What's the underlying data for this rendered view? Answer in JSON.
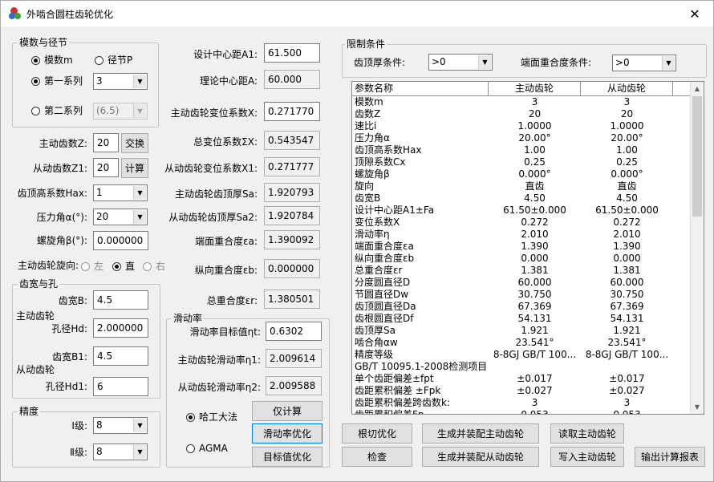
{
  "window": {
    "title": "外啮合圆柱齿轮优化",
    "close_glyph": "✕"
  },
  "module_group": {
    "title": "模数与径节",
    "radio_module": "模数m",
    "radio_pitch": "径节P",
    "radio_series1": "第一系列",
    "series1_value": "3",
    "radio_series2": "第二系列",
    "series2_value": "(6.5)"
  },
  "left_fields": {
    "z1_label": "主动齿数Z:",
    "z1_value": "20",
    "swap_button": "交换",
    "z2_label": "从动齿数Z1:",
    "z2_value": "20",
    "calc_button": "计算",
    "hax_label": "齿顶高系数Hax:",
    "hax_value": "1",
    "alpha_label": "压力角α(°):",
    "alpha_value": "20",
    "beta_label": "螺旋角β(°):",
    "beta_value": "0.000000",
    "direction_label": "主动齿轮旋向:",
    "dir_left": "左",
    "dir_straight": "直",
    "dir_right": "右"
  },
  "width_group": {
    "title": "齿宽与孔",
    "driving_label": "主动齿轮",
    "driven_label": "从动齿轮",
    "b_label": "齿宽B:",
    "b_value": "4.5",
    "hd_label": "孔径Hd:",
    "hd_value": "2.000000",
    "b1_label": "齿宽B1:",
    "b1_value": "4.5",
    "hd1_label": "孔径Hd1:",
    "hd1_value": "6"
  },
  "precision_group": {
    "title": "精度",
    "g1_label": "Ⅰ级:",
    "g1_value": "8",
    "g2_label": "Ⅱ级:",
    "g2_value": "8"
  },
  "mid_fields": {
    "a1_label": "设计中心距A1:",
    "a1_value": "61.500",
    "a_label": "理论中心距A:",
    "a_value": "60.000",
    "x_label": "主动齿轮变位系数X:",
    "x_value": "0.271770",
    "sx_label": "总变位系数ΣX:",
    "sx_value": "0.543547",
    "x1_label": "从动齿轮变位系数X1:",
    "x1_value": "0.271777",
    "sa_label": "主动齿轮齿顶厚Sa:",
    "sa_value": "1.920793",
    "sa2_label": "从动齿轮齿顶厚Sa2:",
    "sa2_value": "1.920784",
    "ea_label": "端面重合度εa:",
    "ea_value": "1.390092",
    "eb_label": "纵向重合度εb:",
    "eb_value": "0.000000",
    "er_label": "总重合度εr:",
    "er_value": "1.380501"
  },
  "slide_group": {
    "title": "滑动率",
    "target_label": "滑动率目标值ηt:",
    "target_value": "0.6302",
    "eta1_label": "主动齿轮滑动率η1:",
    "eta1_value": "2.009614",
    "eta2_label": "从动齿轮滑动率η2:",
    "eta2_value": "2.009588",
    "radio_harbin": "哈工大法",
    "radio_agma": "AGMA",
    "calc_only_button": "仅计算",
    "slide_opt_button": "滑动率优化",
    "target_opt_button": "目标值优化"
  },
  "limit_group": {
    "title": "限制条件",
    "tip_label": "齿顶厚条件:",
    "tip_value": ">0",
    "overlap_label": "端面重合度条件:",
    "overlap_value": ">0"
  },
  "table": {
    "headers": [
      "参数名称",
      "主动齿轮",
      "从动齿轮"
    ],
    "rows": [
      [
        "模数m",
        "3",
        "3"
      ],
      [
        "齿数Z",
        "20",
        "20"
      ],
      [
        "速比i",
        "1.0000",
        "1.0000"
      ],
      [
        "压力角α",
        "20.00°",
        "20.00°"
      ],
      [
        "齿顶高系数Hax",
        "1.00",
        "1.00"
      ],
      [
        "顶隙系数Cx",
        "0.25",
        "0.25"
      ],
      [
        "螺旋角β",
        "0.000°",
        "0.000°"
      ],
      [
        "旋向",
        "直齿",
        "直齿"
      ],
      [
        "齿宽B",
        "4.50",
        "4.50"
      ],
      [
        "设计中心距A1±Fa",
        "61.50±0.000",
        "61.50±0.000"
      ],
      [
        "变位系数X",
        "0.272",
        "0.272"
      ],
      [
        "滑动率η",
        "2.010",
        "2.010"
      ],
      [
        "端面重合度εa",
        "1.390",
        "1.390"
      ],
      [
        "纵向重合度εb",
        "0.000",
        "0.000"
      ],
      [
        "总重合度εr",
        "1.381",
        "1.381"
      ],
      [
        "分度圆直径D",
        "60.000",
        "60.000"
      ],
      [
        "节圆直径Dw",
        "30.750",
        "30.750"
      ],
      [
        "齿顶圆直径Da",
        "67.369",
        "67.369"
      ],
      [
        "齿根圆直径Df",
        "54.131",
        "54.131"
      ],
      [
        "齿顶厚Sa",
        "1.921",
        "1.921"
      ],
      [
        "啮合角αw",
        "23.541°",
        "23.541°"
      ],
      [
        "精度等级",
        "8-8GJ GB/T 100...",
        "8-8GJ GB/T 100..."
      ],
      [
        "GB/T 10095.1-2008检测项目",
        "",
        ""
      ],
      [
        "单个齿距偏差±fpt",
        "±0.017",
        "±0.017"
      ],
      [
        "齿距累积偏差 ±Fpk",
        "±0.027",
        "±0.027"
      ],
      [
        "齿距累积偏差跨齿数k:",
        "3",
        "3"
      ],
      [
        "齿距累积偏差Fp",
        "0.053",
        "0.053"
      ]
    ]
  },
  "bottom_buttons": {
    "undercut": "根切优化",
    "check": "检查",
    "gen_driving": "生成并装配主动齿轮",
    "gen_driven": "生成并装配从动齿轮",
    "read_driving": "读取主动齿轮",
    "write_driving": "写入主动齿轮",
    "export_report": "输出计算报表"
  },
  "icons": {
    "dropdown": "▼",
    "scroll_up": "▲",
    "scroll_down": "▼"
  }
}
